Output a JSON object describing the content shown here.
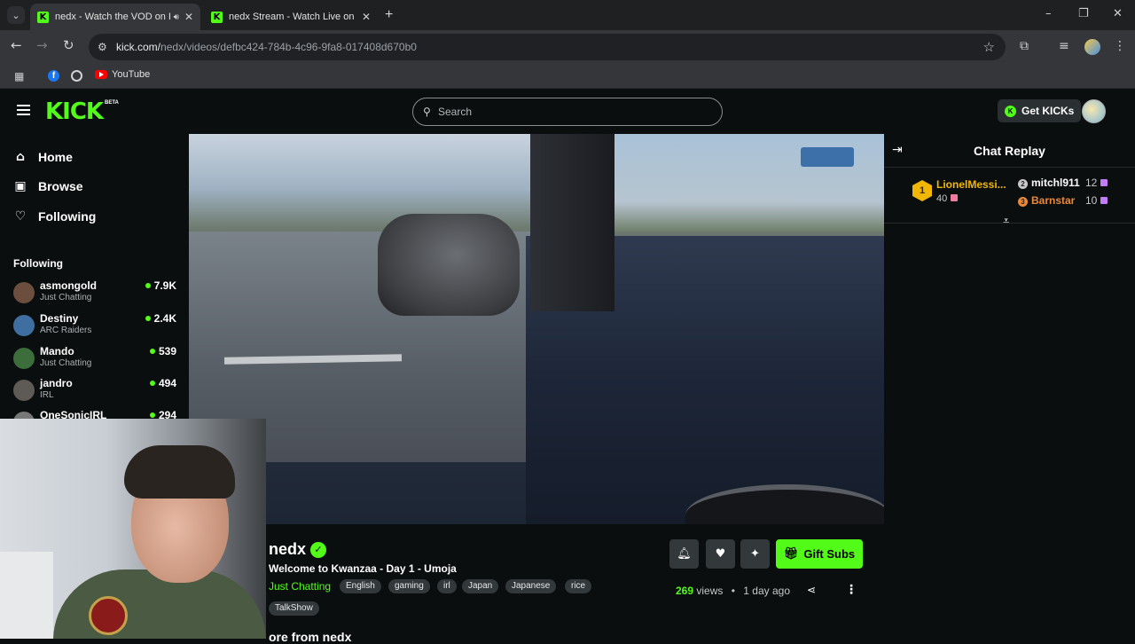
{
  "browser": {
    "tabs": [
      {
        "title": "nedx - Watch the VOD on Ki",
        "favicon": "kick-favicon",
        "active": true,
        "audio": true
      },
      {
        "title": "nedx Stream - Watch Live on Ki",
        "favicon": "kick-favicon",
        "active": false
      }
    ],
    "url_domain": "kick.com/",
    "url_path": "nedx/videos/defbc424-784b-4c96-9fa8-017408d670b0",
    "bookmarks": [
      {
        "label": "YouTube",
        "icon": "youtube-icon"
      }
    ]
  },
  "header": {
    "logo": "KICK",
    "logo_badge": "BETA",
    "search_placeholder": "Search",
    "get_kicks_label": "Get KICKs"
  },
  "sidebar": {
    "nav": [
      {
        "label": "Home",
        "icon": "home-icon"
      },
      {
        "label": "Browse",
        "icon": "browse-icon"
      },
      {
        "label": "Following",
        "icon": "heart-icon"
      }
    ],
    "following_heading": "Following",
    "following": [
      {
        "name": "asmongold",
        "category": "Just Chatting",
        "viewers": "7.9K",
        "avatar_color": "#6b4e3d"
      },
      {
        "name": "Destiny",
        "category": "ARC Raiders",
        "viewers": "2.4K",
        "avatar_color": "#3f6fa0"
      },
      {
        "name": "Mando",
        "category": "Just Chatting",
        "viewers": "539",
        "avatar_color": "#3b6e3b"
      },
      {
        "name": "jandro",
        "category": "IRL",
        "viewers": "494",
        "avatar_color": "#5e5b57"
      },
      {
        "name": "OneSonicIRL",
        "category": "",
        "viewers": "294",
        "avatar_color": "#777777"
      }
    ]
  },
  "stream": {
    "channel": "nedx",
    "title": "Welcome to Kwanzaa - Day 1 - Umoja",
    "category": "Just Chatting",
    "tags": [
      "English",
      "gaming",
      "irl",
      "Japan",
      "Japanese",
      "rice",
      "TalkShow"
    ],
    "gift_label": "Gift Subs",
    "views": "269",
    "views_label": "views",
    "age": "1 day ago",
    "more_from": "ore from nedx"
  },
  "chat": {
    "title": "Chat Replay",
    "leaderboard": [
      {
        "rank": "1",
        "name": "LionelMessi...",
        "value": "40"
      },
      {
        "rank": "2",
        "name": "mitchl911",
        "value": "12"
      },
      {
        "rank": "3",
        "name": "Barnstar",
        "value": "10"
      }
    ]
  },
  "colors": {
    "brand": "#53fc18",
    "background": "#0b0e0f",
    "gold": "#f2b705",
    "bronze": "#e8893a"
  }
}
